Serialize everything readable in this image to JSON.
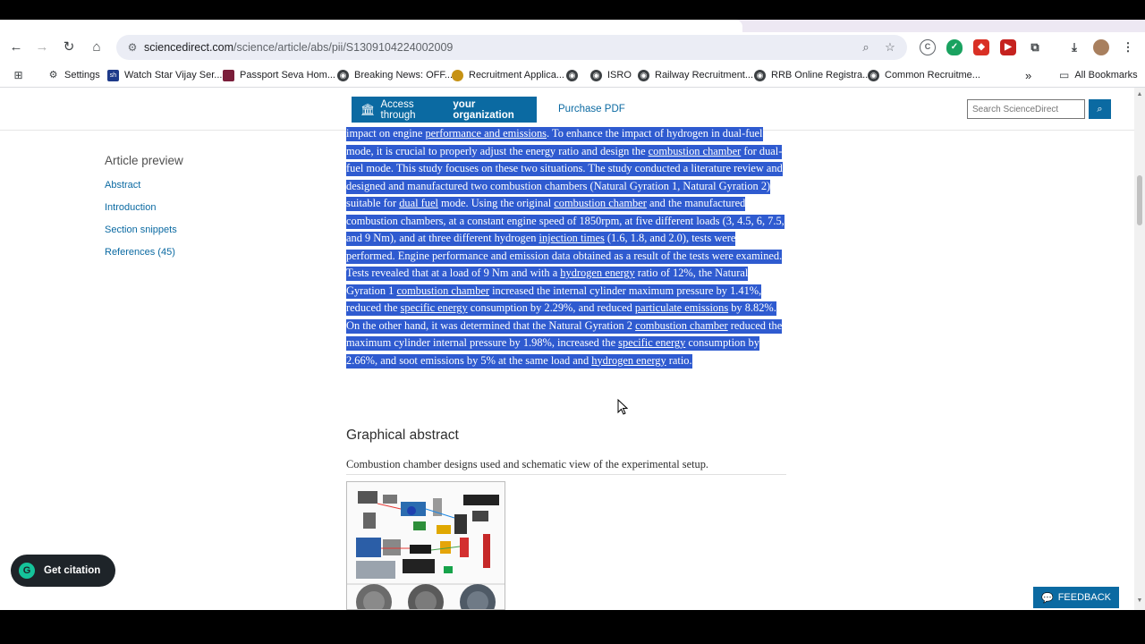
{
  "browser": {
    "url_host": "sciencedirect.com",
    "url_path": "/science/article/abs/pii/S1309104224002009",
    "bookmarks": [
      {
        "label": "Settings",
        "icon": "gear-icon"
      },
      {
        "label": "Watch Star Vijay Ser...",
        "icon": "star-vijay-icon"
      },
      {
        "label": "Passport Seva Hom...",
        "icon": "passport-icon"
      },
      {
        "label": "Breaking News: OFF...",
        "icon": "globe-icon"
      },
      {
        "label": "Recruitment Applica...",
        "icon": "emblem-icon"
      },
      {
        "label": "",
        "icon": "globe-icon"
      },
      {
        "label": "ISRO",
        "icon": "globe-icon"
      },
      {
        "label": "Railway Recruitment...",
        "icon": "globe-icon"
      },
      {
        "label": "RRB Online Registra...",
        "icon": "globe-icon"
      },
      {
        "label": "Common Recruitme...",
        "icon": "globe-icon"
      }
    ],
    "overflow_glyph": "»",
    "all_bookmarks": "All Bookmarks"
  },
  "header": {
    "access_prefix": "Access through",
    "access_bold": "your organization",
    "purchase": "Purchase PDF",
    "search_placeholder": "Search ScienceDirect"
  },
  "sidebar": {
    "title": "Article preview",
    "links": [
      "Abstract",
      "Introduction",
      "Section snippets",
      "References (45)"
    ]
  },
  "abstract": {
    "s0": "impact on engine ",
    "k0": "performance and emissions",
    "s1": ". To enhance the impact of hydrogen in dual-fuel mode, it is crucial to properly adjust the energy ratio and design the ",
    "k1": "combustion chamber",
    "s2": " for dual-fuel mode. This study focuses on these two situations. The study conducted a literature review and designed and manufactured two combustion chambers (Natural Gyration 1, Natural Gyration 2) suitable for ",
    "k2": "dual fuel",
    "s3": " mode. Using the original ",
    "k3": "combustion chamber",
    "s4": " and the manufactured combustion chambers, at a constant engine speed of 1850rpm, at five different loads (3, 4.5, 6, 7.5, and 9 Nm), and at three different hydrogen ",
    "k4": "injection times",
    "s5": " (1.6, 1.8, and 2.0), tests were performed. Engine performance and emission data obtained as a result of the tests were examined. Tests revealed that at a load of 9 Nm and with a ",
    "k5": "hydrogen energy",
    "s6": " ratio of 12%, the Natural Gyration 1 ",
    "k6": "combustion chamber",
    "s7": " increased the internal cylinder maximum pressure by 1.41%, reduced the ",
    "k7": "specific energy",
    "s8": " consumption by 2.29%, and reduced ",
    "k8": "particulate emissions",
    "s9": " by 8.82%. On the other hand, it was determined that the Natural Gyration 2 ",
    "k9": "combustion chamber",
    "s10": " reduced the maximum cylinder internal pressure by 1.98%, increased the ",
    "k10": "specific energy",
    "s11": " consumption by 2.66%, and soot emissions by 5% at the same load and ",
    "k11": "hydrogen energy",
    "s12": " ratio."
  },
  "graphical_abstract": {
    "title": "Graphical abstract",
    "caption": "Combustion chamber designs used and schematic view of the experimental setup."
  },
  "widgets": {
    "citation": "Get citation",
    "citation_glyph": "G",
    "feedback": "FEEDBACK"
  },
  "colors": {
    "accent": "#0b6aa2",
    "selection": "#2f5bd0"
  }
}
